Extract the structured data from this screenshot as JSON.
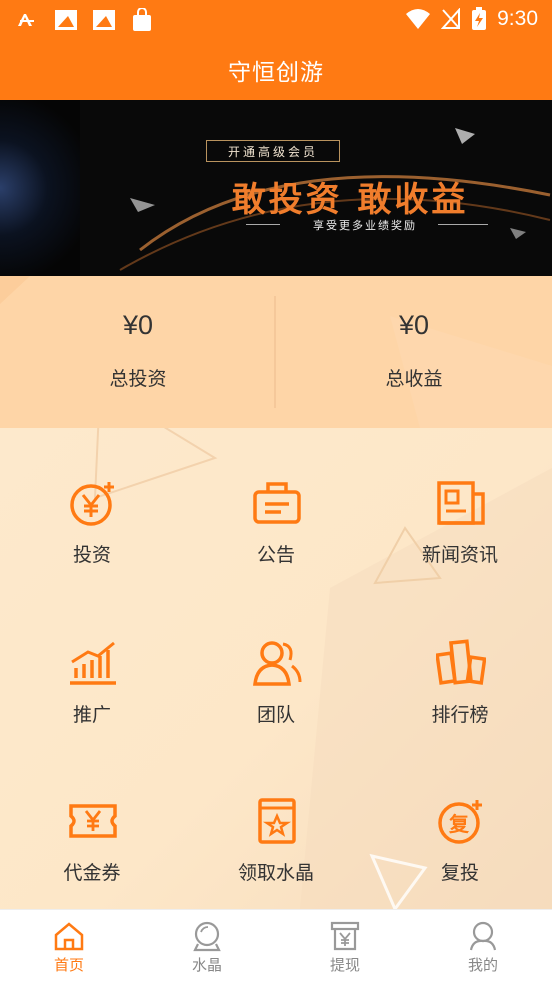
{
  "status_bar": {
    "time": "9:30"
  },
  "app": {
    "title": "守恒创游"
  },
  "banner": {
    "badge": "开通高级会员",
    "headline": "敢投资 敢收益",
    "subline": "享受更多业绩奖励"
  },
  "stats": [
    {
      "value": "¥0",
      "label": "总投资"
    },
    {
      "value": "¥0",
      "label": "总收益"
    }
  ],
  "menu": [
    {
      "label": "投资",
      "icon": "yen-plus-icon"
    },
    {
      "label": "公告",
      "icon": "notice-board-icon"
    },
    {
      "label": "新闻资讯",
      "icon": "newspaper-icon"
    },
    {
      "label": "推广",
      "icon": "bar-chart-icon"
    },
    {
      "label": "团队",
      "icon": "team-icon"
    },
    {
      "label": "排行榜",
      "icon": "ranking-podium-icon"
    },
    {
      "label": "代金券",
      "icon": "voucher-icon"
    },
    {
      "label": "领取水晶",
      "icon": "crystal-book-icon"
    },
    {
      "label": "复投",
      "icon": "reinvest-icon"
    }
  ],
  "bottom_nav": [
    {
      "label": "首页",
      "icon": "home-icon",
      "active": true
    },
    {
      "label": "水晶",
      "icon": "crystal-ball-icon",
      "active": false
    },
    {
      "label": "提现",
      "icon": "withdraw-icon",
      "active": false
    },
    {
      "label": "我的",
      "icon": "user-icon",
      "active": false
    }
  ],
  "colors": {
    "primary": "#ff7a13",
    "stats_bg": "#fed5a7",
    "page_bg": "#fde9cc"
  }
}
